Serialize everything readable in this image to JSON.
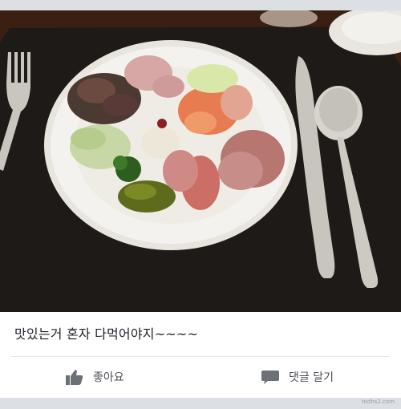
{
  "post": {
    "caption": "맛있는거 혼자 다먹어야지~~~~"
  },
  "actions": {
    "like_label": "좋아요",
    "comment_label": "댓글 달기"
  },
  "footer": {
    "watermark": "todhs2.com"
  },
  "colors": {
    "placemat": "#1c1815",
    "plate": "#f4f2ee",
    "action_text": "#4b4f56",
    "caption_text": "#1d2129"
  }
}
